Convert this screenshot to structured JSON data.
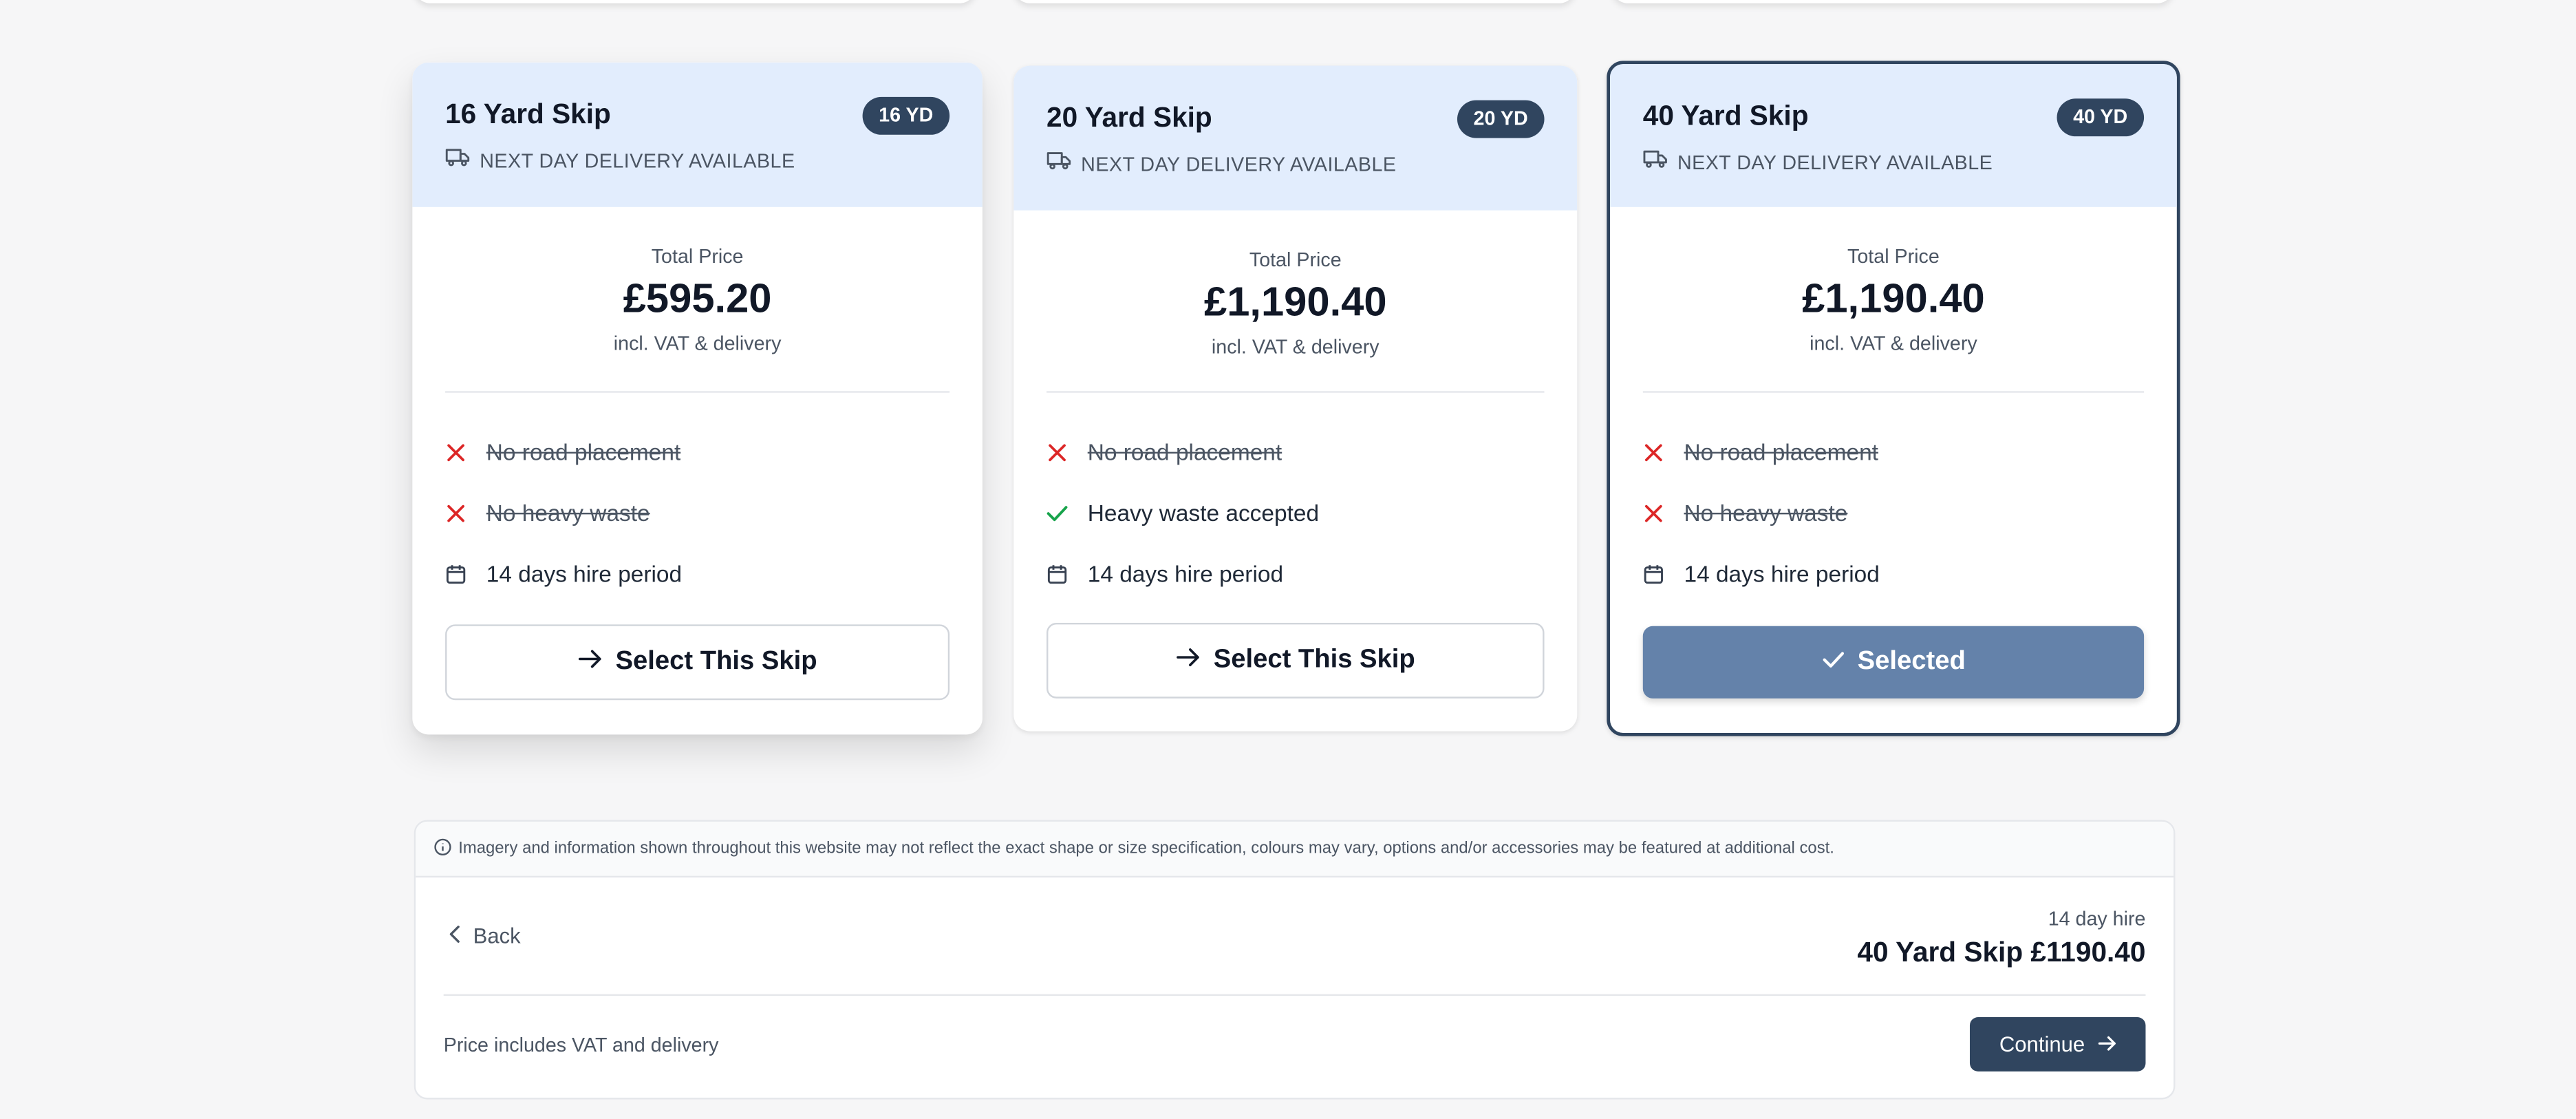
{
  "colors": {
    "accent": "#30455f",
    "selected_button": "#6482aa",
    "card_header": "#e2edfd",
    "cross": "#dc2626",
    "check": "#16a34a"
  },
  "cards": [
    {
      "title": "16 Yard Skip",
      "badge": "16 YD",
      "delivery": "NEXT DAY DELIVERY AVAILABLE",
      "price_label": "Total Price",
      "price": "£595.20",
      "price_note": "incl. VAT & delivery",
      "features": [
        {
          "text": "No road placement",
          "status": "unavailable",
          "icon": "cross-icon"
        },
        {
          "text": "No heavy waste",
          "status": "unavailable",
          "icon": "cross-icon"
        },
        {
          "text": "14 days hire period",
          "status": "info",
          "icon": "calendar-icon"
        }
      ],
      "button_label": "Select This Skip",
      "button_icon": "arrow-right-icon",
      "selected": false
    },
    {
      "title": "20 Yard Skip",
      "badge": "20 YD",
      "delivery": "NEXT DAY DELIVERY AVAILABLE",
      "price_label": "Total Price",
      "price": "£1,190.40",
      "price_note": "incl. VAT & delivery",
      "features": [
        {
          "text": "No road placement",
          "status": "unavailable",
          "icon": "cross-icon"
        },
        {
          "text": "Heavy waste accepted",
          "status": "available",
          "icon": "check-icon"
        },
        {
          "text": "14 days hire period",
          "status": "info",
          "icon": "calendar-icon"
        }
      ],
      "button_label": "Select This Skip",
      "button_icon": "arrow-right-icon",
      "selected": false
    },
    {
      "title": "40 Yard Skip",
      "badge": "40 YD",
      "delivery": "NEXT DAY DELIVERY AVAILABLE",
      "price_label": "Total Price",
      "price": "£1,190.40",
      "price_note": "incl. VAT & delivery",
      "features": [
        {
          "text": "No road placement",
          "status": "unavailable",
          "icon": "cross-icon"
        },
        {
          "text": "No heavy waste",
          "status": "unavailable",
          "icon": "cross-icon"
        },
        {
          "text": "14 days hire period",
          "status": "info",
          "icon": "calendar-icon"
        }
      ],
      "button_label": "Selected",
      "button_icon": "check-icon",
      "selected": true
    }
  ],
  "footer": {
    "disclaimer": "Imagery and information shown throughout this website may not reflect the exact shape or size specification, colours may vary, options and/or accessories may be featured at additional cost.",
    "back_label": "Back",
    "hire_period": "14 day hire",
    "summary": "40 Yard Skip £1190.40",
    "price_includes": "Price includes VAT and delivery",
    "continue_label": "Continue"
  }
}
